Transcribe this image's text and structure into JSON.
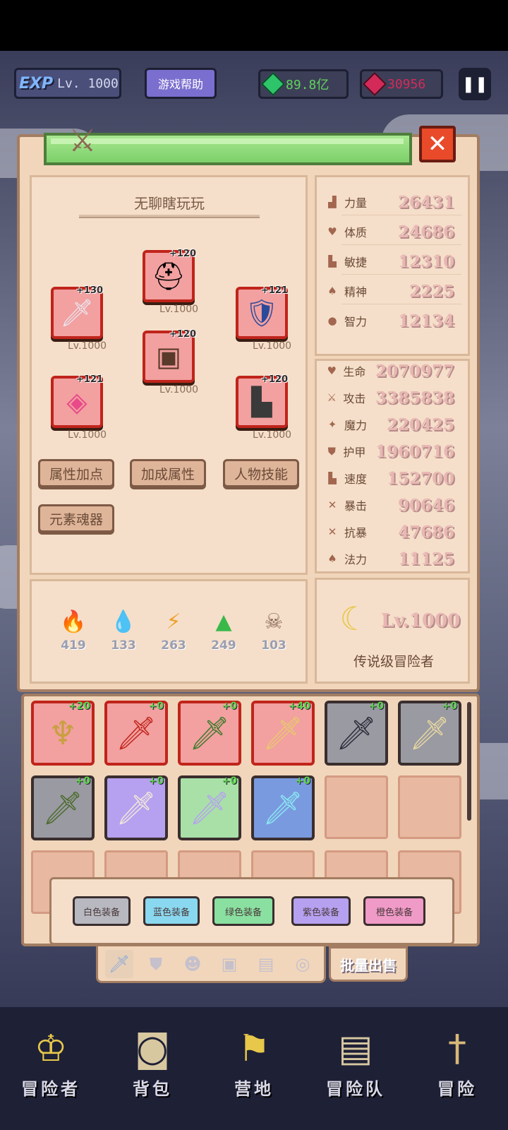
{
  "topbar": {
    "exp_logo": "EXP",
    "level": "Lv. 1000",
    "help_label": "游戏帮助",
    "gems": "89.8亿",
    "rubies": "30956",
    "pause_symbol": "❚❚"
  },
  "character": {
    "name": "无聊瞎玩玩",
    "equipment": [
      {
        "slot": "helmet",
        "plus": "+120",
        "level": "Lv.1000",
        "icon": "helmet-icon"
      },
      {
        "slot": "weapon",
        "plus": "+130",
        "level": "Lv.1000",
        "icon": "sword-icon"
      },
      {
        "slot": "shield",
        "plus": "+121",
        "level": "Lv.1000",
        "icon": "shield-icon"
      },
      {
        "slot": "armor",
        "plus": "+120",
        "level": "Lv.1000",
        "icon": "armor-icon"
      },
      {
        "slot": "necklace",
        "plus": "+121",
        "level": "Lv.1000",
        "icon": "necklace-icon"
      },
      {
        "slot": "boots",
        "plus": "+120",
        "level": "Lv.1000",
        "icon": "boots-icon"
      }
    ],
    "buttons": [
      "属性加点",
      "加成属性",
      "人物技能",
      "元素魂器"
    ]
  },
  "elements": [
    {
      "name": "fire",
      "value": "419",
      "color": "#f04a1a"
    },
    {
      "name": "water",
      "value": "133",
      "color": "#4a8ef0"
    },
    {
      "name": "lightning",
      "value": "263",
      "color": "#f0a02a"
    },
    {
      "name": "earth",
      "value": "249",
      "color": "#3ab84a"
    },
    {
      "name": "dark",
      "value": "103",
      "color": "#8a6a5a"
    }
  ],
  "base_stats": [
    {
      "label": "力量",
      "value": "26431"
    },
    {
      "label": "体质",
      "value": "24686"
    },
    {
      "label": "敏捷",
      "value": "12310"
    },
    {
      "label": "精神",
      "value": "2225"
    },
    {
      "label": "智力",
      "value": "12134"
    }
  ],
  "combat_stats": [
    {
      "label": "生命",
      "value": "2070977"
    },
    {
      "label": "攻击",
      "value": "3385838"
    },
    {
      "label": "魔力",
      "value": "220425"
    },
    {
      "label": "护甲",
      "value": "1960716"
    },
    {
      "label": "速度",
      "value": "152700"
    },
    {
      "label": "暴击",
      "value": "90646"
    },
    {
      "label": "抗暴",
      "value": "47686"
    },
    {
      "label": "法力",
      "value": "11125"
    }
  ],
  "rank": {
    "level": "Lv.1000",
    "title": "传说级冒险者"
  },
  "inventory": [
    {
      "plus": "+20",
      "bg": "#f2a0a0",
      "border": "#c0241b",
      "icon": "trident-icon"
    },
    {
      "plus": "+0",
      "bg": "#f2a0a0",
      "border": "#c0241b",
      "icon": "greatsword-icon"
    },
    {
      "plus": "+0",
      "bg": "#f2a0a0",
      "border": "#c0241b",
      "icon": "green-sword-icon"
    },
    {
      "plus": "+40",
      "bg": "#f2a0a0",
      "border": "#c0241b",
      "icon": "gold-sword-icon"
    },
    {
      "plus": "+0",
      "bg": "#9a9aa2",
      "border": "#3a2e2e",
      "icon": "dark-dagger-icon"
    },
    {
      "plus": "+0",
      "bg": "#9a9aa2",
      "border": "#3a2e2e",
      "icon": "gold-sword-icon"
    },
    {
      "plus": "+0",
      "bg": "#9a9aa2",
      "border": "#3a2e2e",
      "icon": "green-blade-icon"
    },
    {
      "plus": "+0",
      "bg": "#b6a0f0",
      "border": "#3a2e2e",
      "icon": "bone-sword-icon"
    },
    {
      "plus": "+0",
      "bg": "#a8e0a8",
      "border": "#3a2e2e",
      "icon": "crystal-sword-icon"
    },
    {
      "plus": "+0",
      "bg": "#7a9ae0",
      "border": "#3a2e2e",
      "icon": "ice-sword-icon"
    }
  ],
  "filters": [
    {
      "label": "白色装备",
      "bg": "#b8b8c0"
    },
    {
      "label": "蓝色装备",
      "bg": "#8ad8f0"
    },
    {
      "label": "绿色装备",
      "bg": "#8ae0a0"
    },
    {
      "label": "紫色装备",
      "bg": "#b6a0f0"
    },
    {
      "label": "橙色装备",
      "bg": "#f09ac8"
    }
  ],
  "tabs": [
    "sword-icon",
    "shield-icon",
    "helmet-icon",
    "armor-icon",
    "necklace-icon",
    "ring-icon"
  ],
  "sell_label": "批量出售",
  "nav": [
    {
      "label": "冒险者",
      "icon": "crown-icon"
    },
    {
      "label": "背包",
      "icon": "backpack-icon"
    },
    {
      "label": "营地",
      "icon": "camp-icon"
    },
    {
      "label": "冒险队",
      "icon": "book-icon"
    },
    {
      "label": "冒险",
      "icon": "dagger-icon"
    }
  ]
}
